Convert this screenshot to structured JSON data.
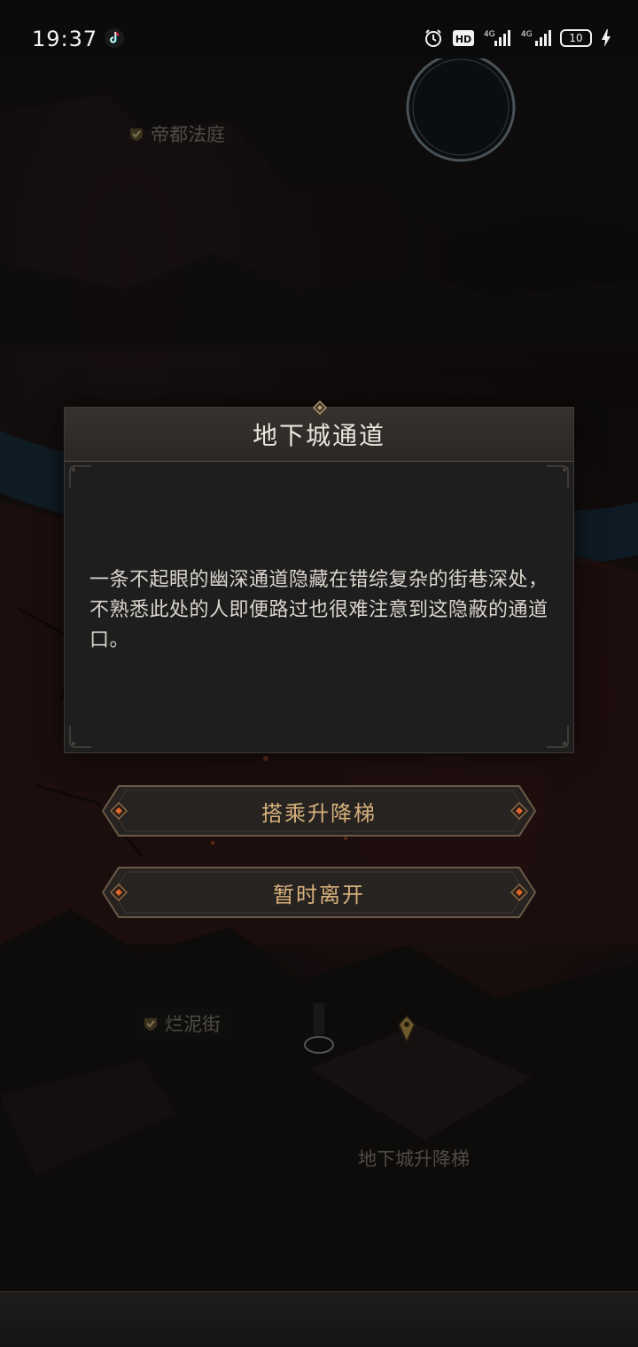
{
  "status_bar": {
    "time": "19:37",
    "network_1": "4G",
    "network_2": "4G",
    "hd_label": "HD",
    "battery": "10"
  },
  "map": {
    "labels": {
      "court": "帝都法庭",
      "mud_street": "烂泥街",
      "elevator": "地下城升降梯"
    }
  },
  "dialog": {
    "title": "地下城通道",
    "body": "一条不起眼的幽深通道隐藏在错综复杂的街巷深处，不熟悉此处的人即便路过也很难注意到这隐蔽的通道口。"
  },
  "actions": {
    "ride_elevator": "搭乘升降梯",
    "leave": "暂时离开"
  },
  "colors": {
    "accent_gold": "#d7b17c",
    "ember": "#e0652b",
    "dialog_bg": "#1f1e1e"
  }
}
